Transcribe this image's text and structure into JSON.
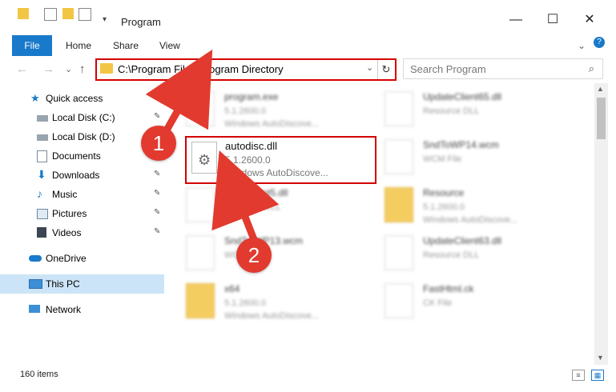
{
  "window": {
    "title": "Program",
    "minimize": "—",
    "maximize": "☐",
    "close": "✕"
  },
  "ribbon": {
    "tabs": [
      "File",
      "Home",
      "Share",
      "View"
    ],
    "expand": "⌄",
    "help": "?"
  },
  "nav": {
    "back": "←",
    "forward": "→",
    "recent": "⌄",
    "up": "↑",
    "address": "C:\\Program Files\\Program Directory",
    "address_dropdown": "⌄",
    "refresh": "↻",
    "search_placeholder": "Search Program",
    "search_icon": "⌕"
  },
  "sidebar": {
    "items": [
      {
        "label": "Quick access",
        "icon": "star-icon",
        "pinned": false
      },
      {
        "label": "Local Disk (C:)",
        "icon": "drive-icon",
        "pinned": true
      },
      {
        "label": "Local Disk (D:)",
        "icon": "drive-icon",
        "pinned": true
      },
      {
        "label": "Documents",
        "icon": "documents-icon",
        "pinned": true
      },
      {
        "label": "Downloads",
        "icon": "download-icon",
        "pinned": true
      },
      {
        "label": "Music",
        "icon": "music-icon",
        "pinned": true
      },
      {
        "label": "Pictures",
        "icon": "pictures-icon",
        "pinned": true
      },
      {
        "label": "Videos",
        "icon": "videos-icon",
        "pinned": true
      },
      {
        "label": "OneDrive",
        "icon": "cloud-icon",
        "pinned": false
      },
      {
        "label": "This PC",
        "icon": "computer-icon",
        "pinned": false,
        "selected": true
      },
      {
        "label": "Network",
        "icon": "network-icon",
        "pinned": false
      }
    ],
    "pin_glyph": "📌"
  },
  "files": [
    {
      "name": "program.exe",
      "line2": "5.1.2600.0",
      "line3": "Windows AutoDiscove...",
      "type": "exe"
    },
    {
      "name": "UpdateClient65.dll",
      "line2": "Resource DLL",
      "line3": "",
      "type": "file"
    },
    {
      "name": "SndToWP14.wcm",
      "line2": "WCM File",
      "line3": "",
      "type": "file"
    },
    {
      "name": "...ateClient5.dll",
      "line2": "Resource DLL",
      "line3": "",
      "type": "file"
    },
    {
      "name": "Resource",
      "line2": "5.1.2600.0",
      "line3": "Windows AutoDiscove...",
      "type": "folder"
    },
    {
      "name": "SndT...WP13.wcm",
      "line2": "WC...",
      "line3": "",
      "type": "file"
    },
    {
      "name": "UpdateClient63.dll",
      "line2": "Resource DLL",
      "line3": "",
      "type": "file"
    },
    {
      "name": "x64",
      "line2": "5.1.2600.0",
      "line3": "Windows AutoDiscove...",
      "type": "folder"
    },
    {
      "name": "FastHtml.ck",
      "line2": "CK File",
      "line3": "",
      "type": "file"
    }
  ],
  "highlighted_file": {
    "name": "autodisc.dll",
    "line2": "5.1.2600.0",
    "line3": "Windows AutoDiscove..."
  },
  "status": {
    "count": "160 items"
  },
  "callouts": {
    "one": "1",
    "two": "2"
  },
  "colors": {
    "accent": "#1979ca",
    "highlight": "#d40000",
    "callout": "#e23a2f",
    "selected": "#cce4f7"
  }
}
